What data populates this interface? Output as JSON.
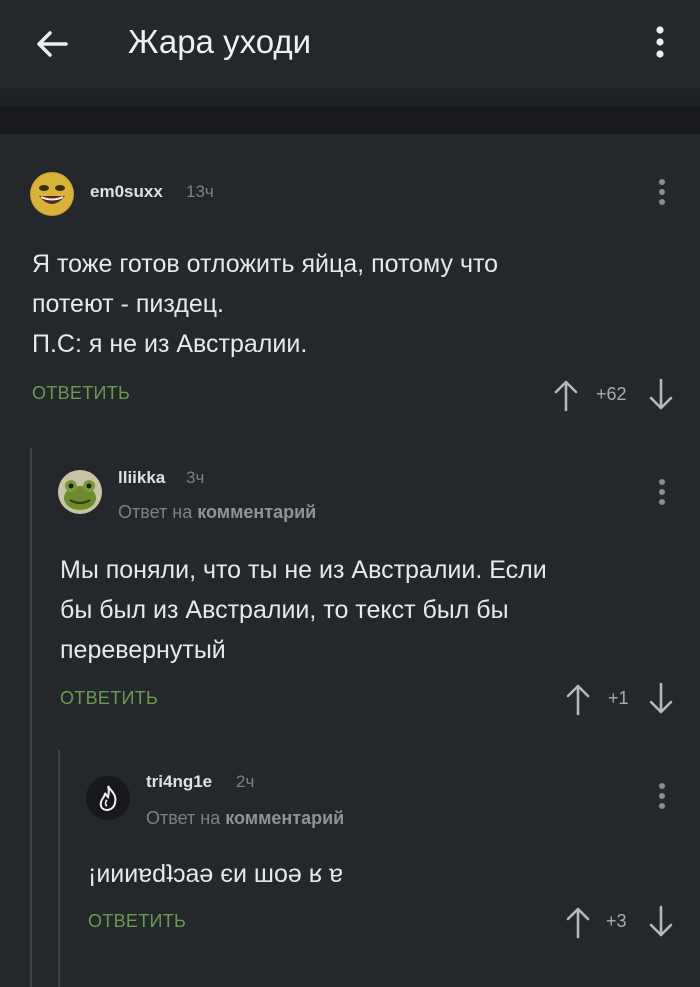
{
  "app": {
    "title": "Жара уходи",
    "back_icon": "arrow-left-icon",
    "menu_icon": "more-vertical-icon"
  },
  "colors": {
    "background": "#24282c",
    "reply_link": "#6a9a4c",
    "muted": "#7d8186"
  },
  "comments": [
    {
      "username": "em0suxx",
      "time": "13ч",
      "reply_to": "",
      "lines": [
        "Я тоже готов отложить яйца, потому что",
        "потеют - пиздец.",
        "П.С: я не из Австралии."
      ],
      "reply_label": "ОТВЕТИТЬ",
      "score": "+62"
    },
    {
      "username": "lliikka",
      "time": "3ч",
      "reply_to_prefix": "Ответ на",
      "reply_to_target": "комментарий",
      "lines": [
        "Мы поняли, что ты не из Австралии. Если",
        "бы был из Австралии, то текст был бы",
        "перевернутый"
      ],
      "reply_label": "ОТВЕТИТЬ",
      "score": "+1"
    },
    {
      "username": "tri4ng1e",
      "time": "2ч",
      "reply_to_prefix": "Ответ на",
      "reply_to_target": "комментарий",
      "lines": [
        "¡иииɐdʇɔаǝ єи шоǝ ʁ ɐ"
      ],
      "reply_label": "ОТВЕТИТЬ",
      "score": "+3"
    }
  ]
}
